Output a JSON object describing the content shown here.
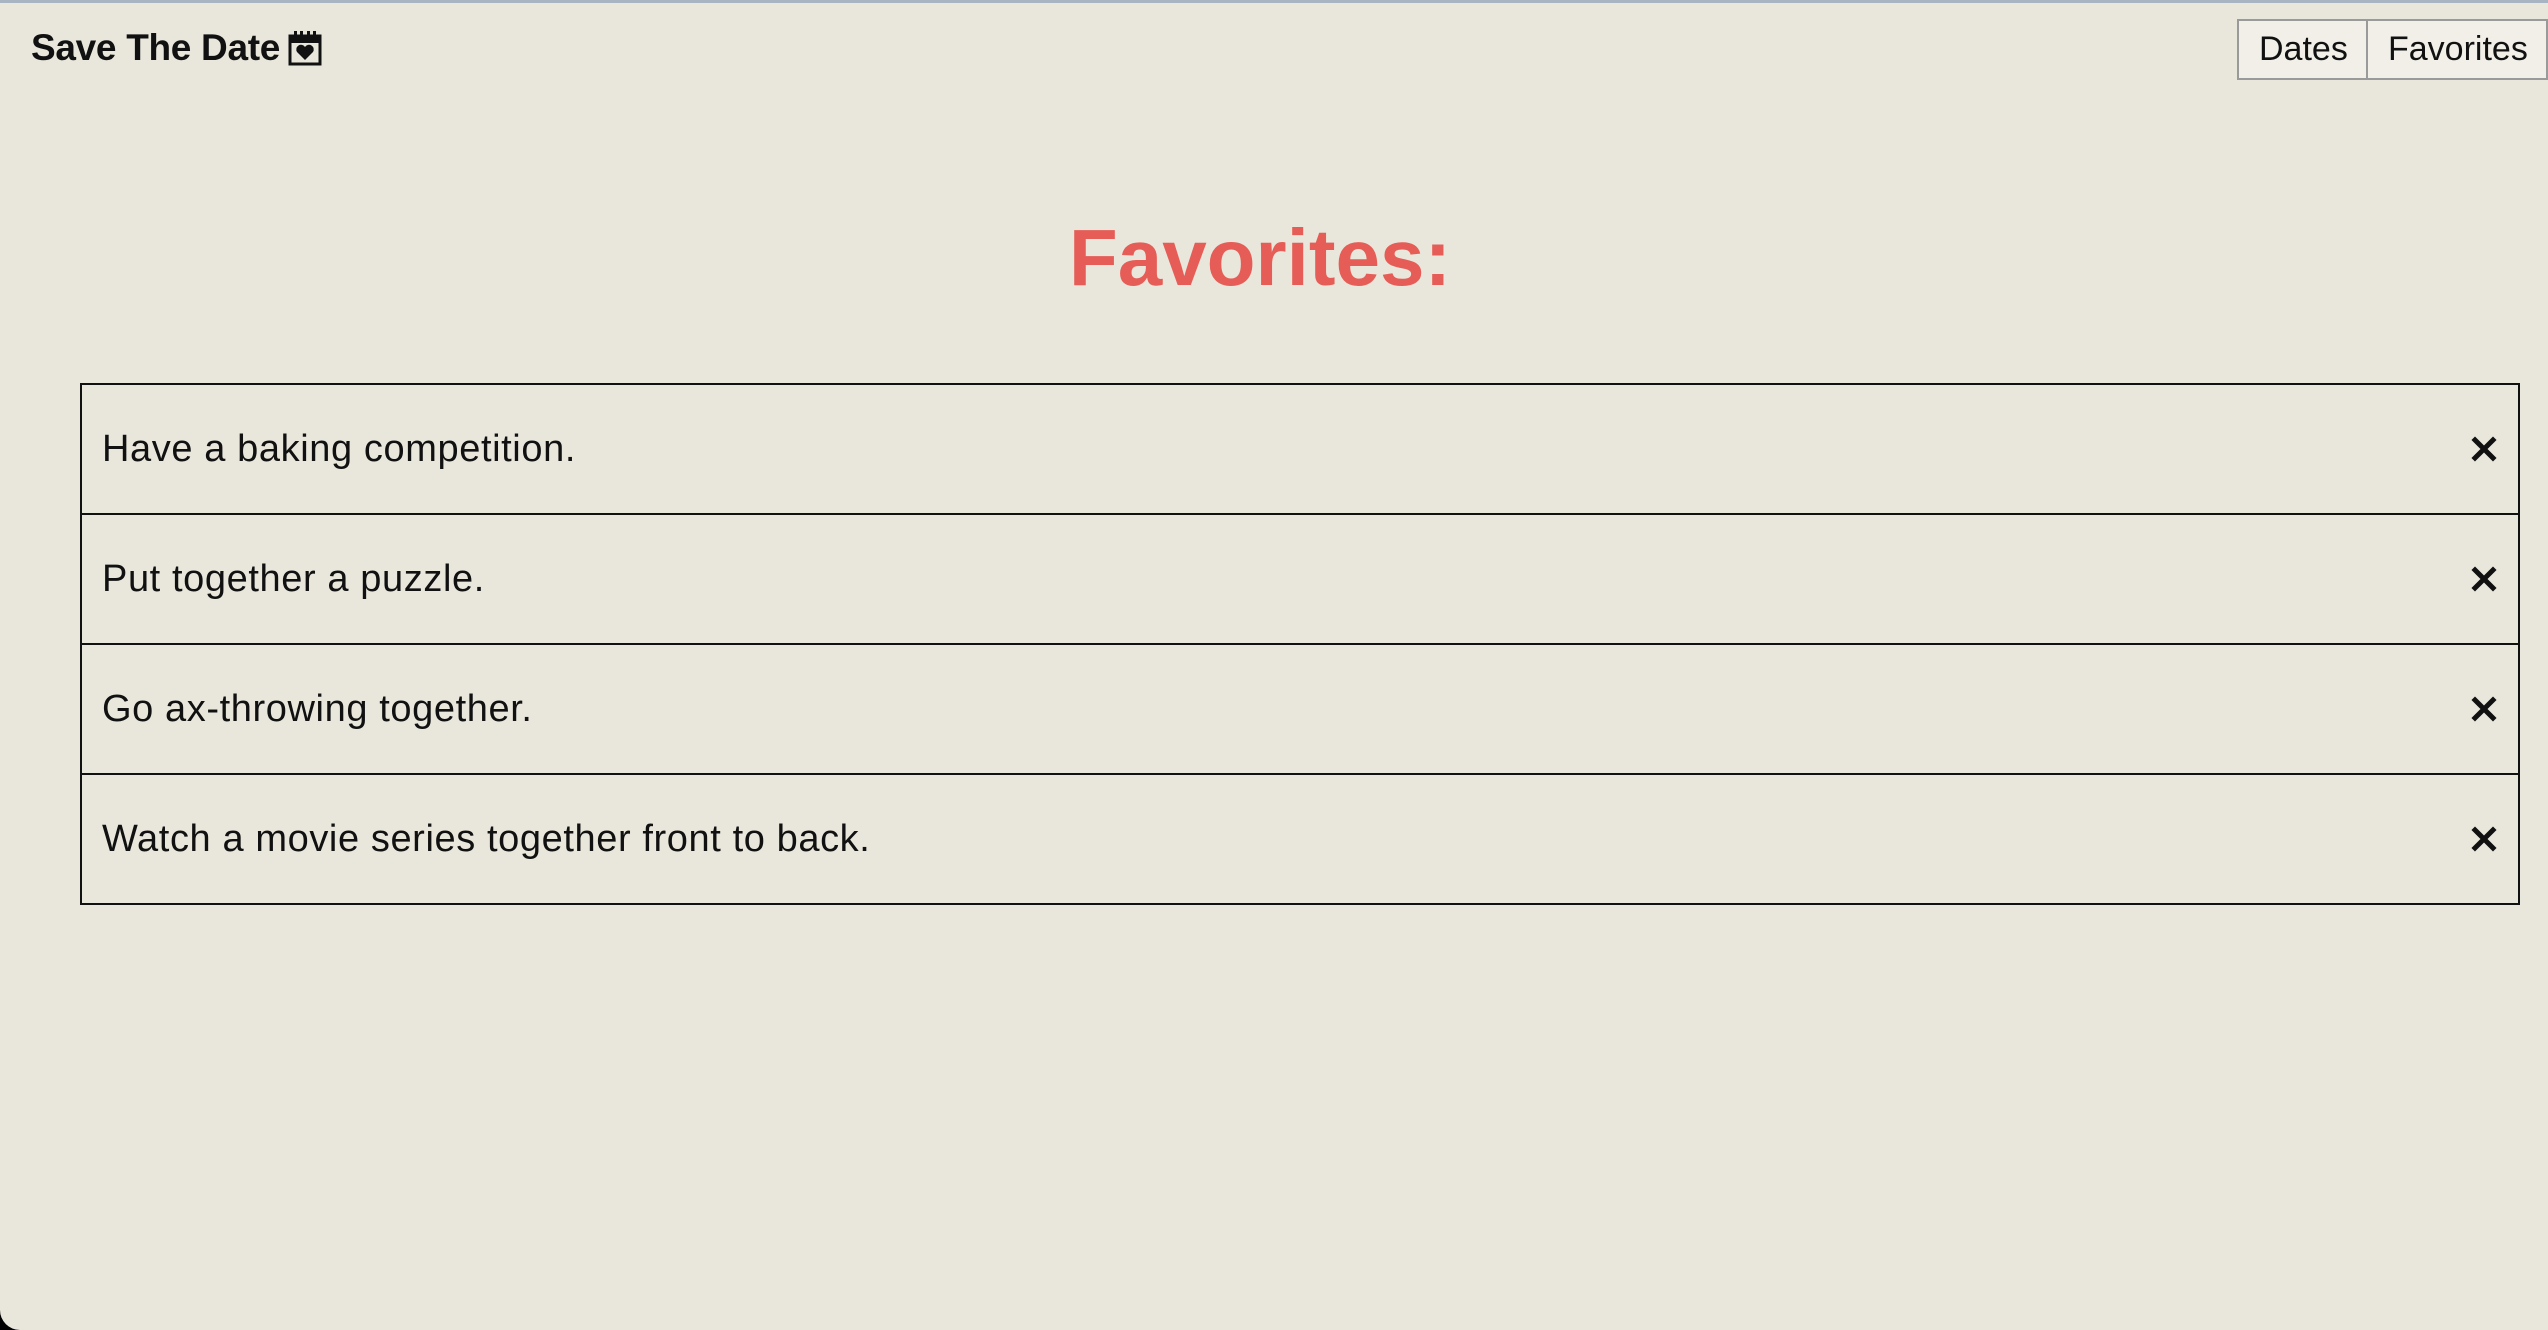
{
  "header": {
    "brand": "Save The Date",
    "brand_icon": "calendar-heart-icon",
    "nav": {
      "dates": "Dates",
      "favorites": "Favorites"
    }
  },
  "main": {
    "title": "Favorites:",
    "items": [
      {
        "text": "Have a baking competition.",
        "remove_icon": "close-icon"
      },
      {
        "text": "Put together a puzzle.",
        "remove_icon": "close-icon"
      },
      {
        "text": "Go ax-throwing together.",
        "remove_icon": "close-icon"
      },
      {
        "text": "Watch a movie series together front to back.",
        "remove_icon": "close-icon"
      }
    ]
  },
  "colors": {
    "background": "#e9e7dc",
    "accent": "#e55d56",
    "text": "#111111"
  }
}
